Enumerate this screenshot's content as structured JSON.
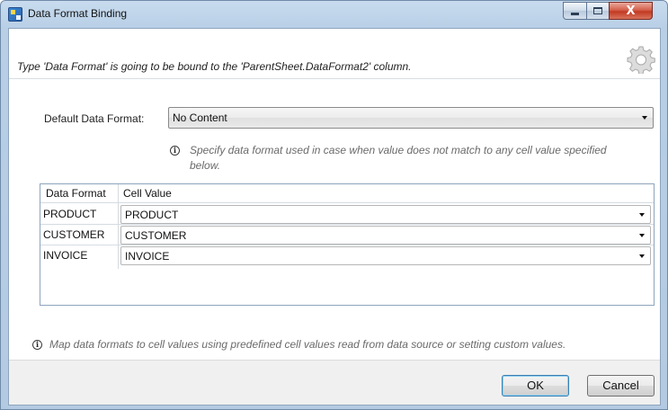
{
  "window": {
    "title": "Data Format Binding",
    "icon": "data-format-binding-app-icon",
    "controls": {
      "minimize_icon": "minimize-icon",
      "maximize_icon": "maximize-icon",
      "close_icon": "close-icon",
      "close_glyph": "X"
    }
  },
  "header": {
    "message": "Type 'Data Format' is going to be bound to the 'ParentSheet.DataFormat2' column.",
    "icon": "gear-icon"
  },
  "default_format": {
    "label": "Default Data Format:",
    "selected": "No Content",
    "hint": "Specify data format used in case when value does not match to any cell value specified below.",
    "hint_icon": "info-icon"
  },
  "grid": {
    "columns": [
      "Data Format",
      "Cell Value"
    ],
    "rows": [
      {
        "format": "PRODUCT",
        "value": "PRODUCT"
      },
      {
        "format": "CUSTOMER",
        "value": "CUSTOMER"
      },
      {
        "format": "INVOICE",
        "value": "INVOICE"
      }
    ]
  },
  "footer_hint": {
    "text": "Map data formats to cell values using predefined cell values read from data source or setting custom values.",
    "icon": "info-icon"
  },
  "buttons": {
    "ok": "OK",
    "cancel": "Cancel"
  },
  "colors": {
    "titlebar": "#b8cfe6",
    "close_button": "#c23a22",
    "ok_focus_border": "#3c7fb1"
  }
}
